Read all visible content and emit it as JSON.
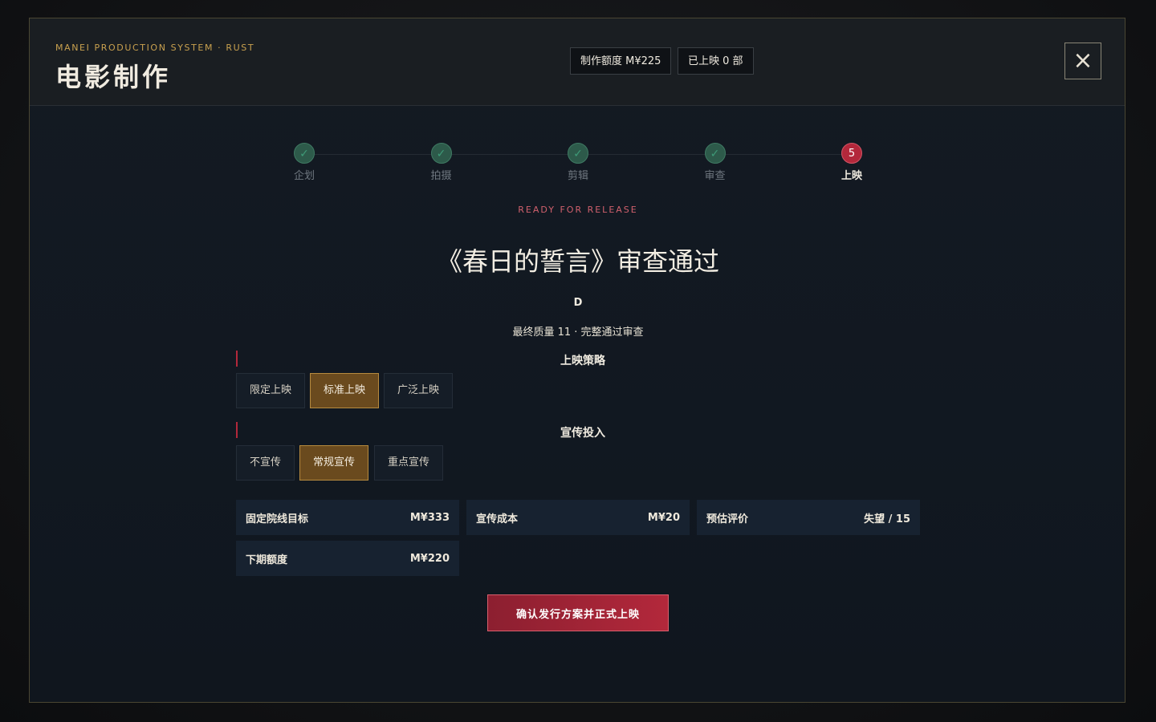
{
  "header": {
    "eyebrow": "MANEI PRODUCTION SYSTEM  ·  RUST",
    "title": "电影制作",
    "budget_pill": "制作额度 M¥225",
    "released_pill": "已上映 0 部",
    "close_icon": "×"
  },
  "steps": [
    {
      "label": "企划",
      "status": "done",
      "icon": "✓"
    },
    {
      "label": "拍摄",
      "status": "done",
      "icon": "✓"
    },
    {
      "label": "剪辑",
      "status": "done",
      "icon": "✓"
    },
    {
      "label": "审查",
      "status": "done",
      "icon": "✓"
    },
    {
      "label": "上映",
      "status": "active",
      "icon": "5"
    }
  ],
  "main": {
    "eyebrow": "READY FOR RELEASE",
    "film_title": "《春日的誓言》审查通过",
    "grade": "D",
    "summary": "最终质量 11 · 完整通过审查"
  },
  "release_strategy": {
    "title": "上映策略",
    "options": [
      "限定上映",
      "标准上映",
      "广泛上映"
    ],
    "selected": "标准上映"
  },
  "promotion": {
    "title": "宣传投入",
    "options": [
      "不宣传",
      "常规宣传",
      "重点宣传"
    ],
    "selected": "常规宣传"
  },
  "stats": [
    {
      "label": "固定院线目标",
      "value": "M¥333"
    },
    {
      "label": "宣传成本",
      "value": "M¥20"
    },
    {
      "label": "预估评价",
      "value": "失望 / 15"
    },
    {
      "label": "下期额度",
      "value": "M¥220"
    }
  ],
  "confirm_label": "确认发行方案并正式上映",
  "colors": {
    "accent_gold": "#c9a14f",
    "accent_red": "#b3283b",
    "step_done": "#2d5a4a",
    "selected_option": "#6a4a1e"
  }
}
